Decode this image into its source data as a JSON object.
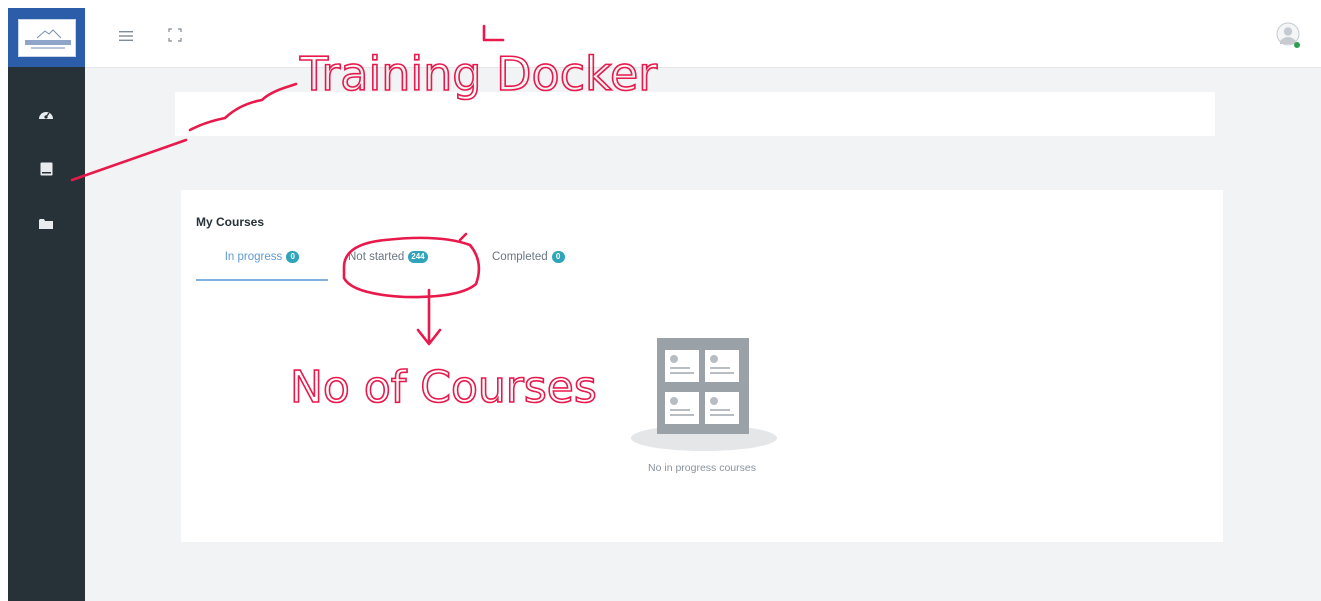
{
  "sidebar": {
    "items": [
      {
        "icon": "dashboard-icon"
      },
      {
        "icon": "book-icon"
      },
      {
        "icon": "folder-icon"
      }
    ]
  },
  "topbar": {
    "menu_icon": "hamburger-menu-icon",
    "fullscreen_icon": "fullscreen-icon",
    "avatar_icon": "user-avatar-icon",
    "online_status_color": "#2e9e52"
  },
  "courses": {
    "title": "My Courses",
    "tabs": [
      {
        "label": "In progress",
        "count": "0"
      },
      {
        "label": "Not started",
        "count": "244"
      },
      {
        "label": "Completed",
        "count": "0"
      }
    ],
    "empty_message": "No in progress courses"
  },
  "annotations": {
    "training_label": "Training Docker",
    "courses_label": "No of Courses",
    "ink_color": "#e8194b"
  },
  "colors": {
    "sidebar_bg": "#263238",
    "logo_bg": "#2b5da8",
    "content_bg": "#f1f3f4",
    "badge_bg": "#2fa4bb",
    "active_tab": "#5f9bd4"
  }
}
